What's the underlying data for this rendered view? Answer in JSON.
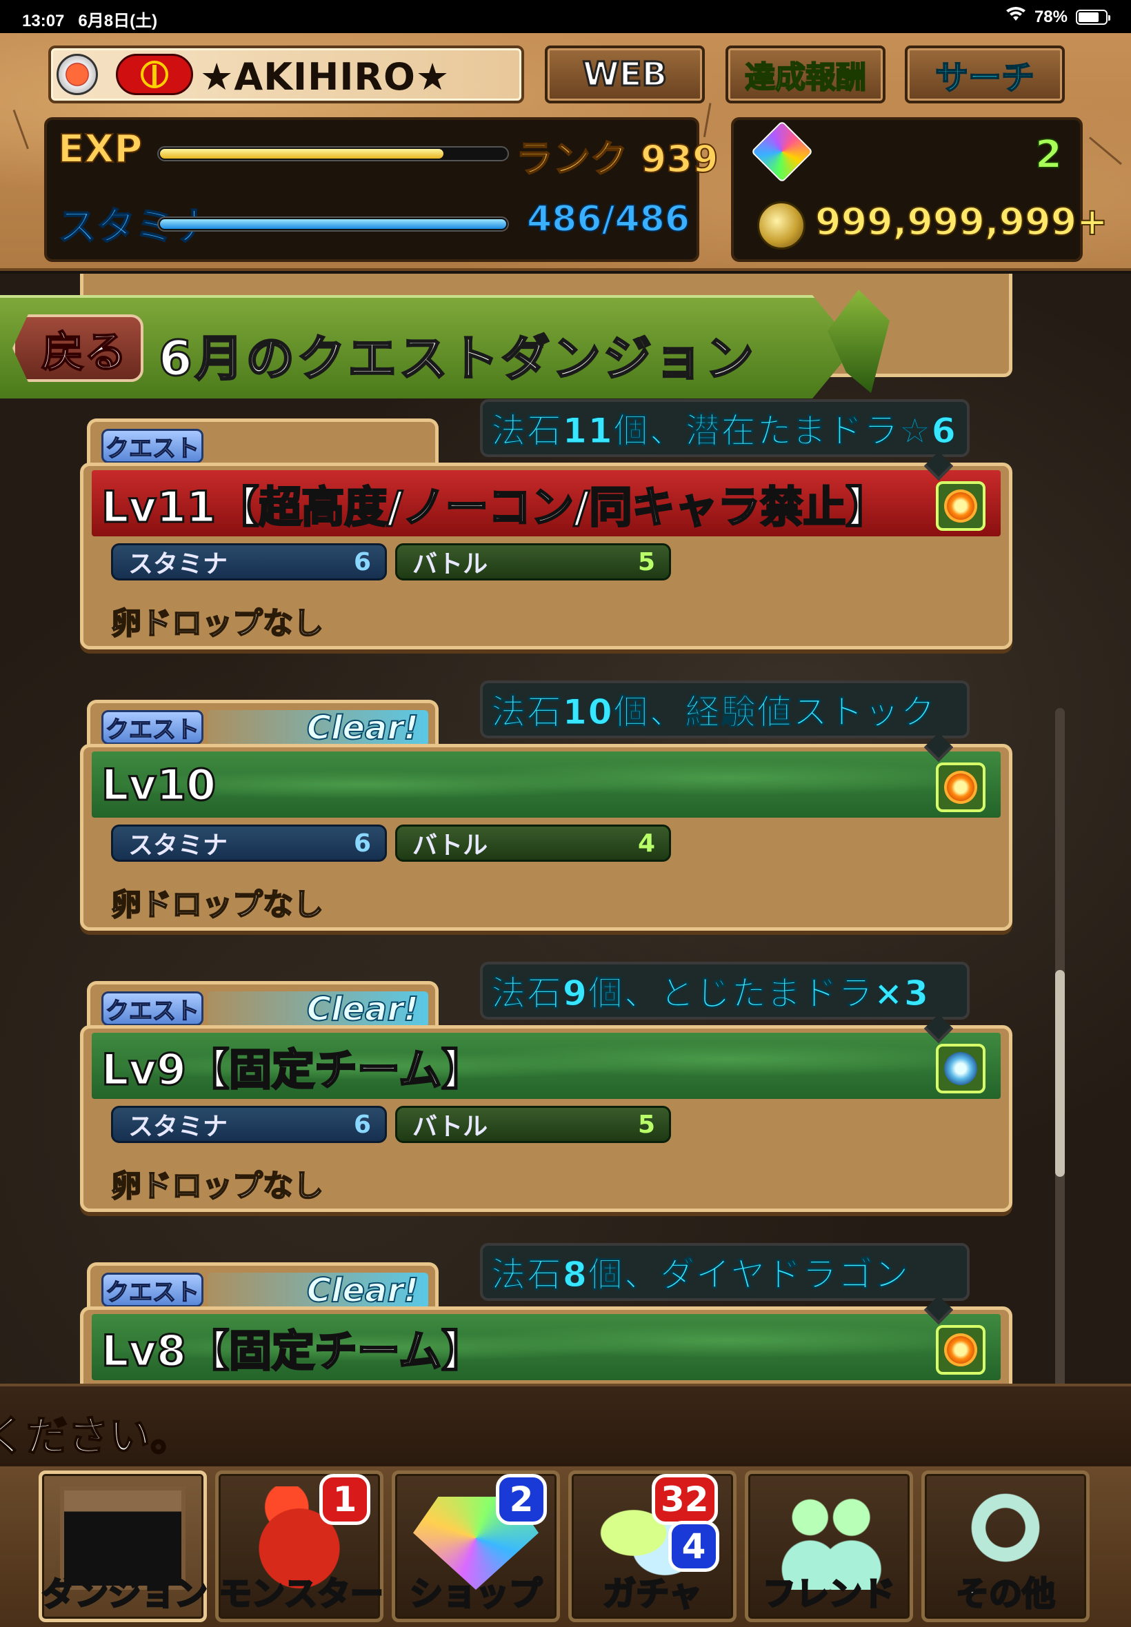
{
  "status": {
    "time": "13:07",
    "date": "6月8日(土)",
    "battery": "78%",
    "battery_level": 0.78
  },
  "header": {
    "player_name": "★AKIHIRO★",
    "web_button": "WEB",
    "reward_button": "達成報酬",
    "search_button": "サーチ",
    "exp_label": "EXP",
    "exp_progress": 0.82,
    "rank": "ランク 939",
    "stamina_label": "スタミナ",
    "stamina_progress": 1.0,
    "stamina_value": "486/486",
    "magic_stones": "2",
    "coins": "999,999,999+"
  },
  "nav": {
    "back_label": "戻る",
    "title": "6月のクエストダンジョン"
  },
  "cards": [
    {
      "tag": "クエスト",
      "clear": "",
      "reward": "法石11個、潜在たまドラ☆6",
      "title": "Lv11【超高度/ノーコン/同キャラ禁止】",
      "band": "red",
      "attr": "fire",
      "stamina_label": "スタミナ",
      "stamina": "6",
      "battle_label": "バトル",
      "battle": "5",
      "egg": "卵ドロップなし"
    },
    {
      "tag": "クエスト",
      "clear": "Clear!",
      "reward": "法石10個、経験値ストック",
      "title": "Lv10",
      "band": "green",
      "attr": "fire",
      "stamina_label": "スタミナ",
      "stamina": "6",
      "battle_label": "バトル",
      "battle": "4",
      "egg": "卵ドロップなし"
    },
    {
      "tag": "クエスト",
      "clear": "Clear!",
      "reward": "法石9個、とじたまドラ×3",
      "title": "Lv9【固定チーム】",
      "band": "green",
      "attr": "water",
      "stamina_label": "スタミナ",
      "stamina": "6",
      "battle_label": "バトル",
      "battle": "5",
      "egg": "卵ドロップなし"
    },
    {
      "tag": "クエスト",
      "clear": "Clear!",
      "reward": "法石8個、ダイヤドラゴン",
      "title": "Lv8【固定チーム】",
      "band": "green",
      "attr": "fire"
    }
  ],
  "message": "ください。",
  "tabs": [
    {
      "label": "ダンジョン",
      "badge": "",
      "badge2": ""
    },
    {
      "label": "モンスター",
      "badge": "1",
      "badge2": ""
    },
    {
      "label": "ショップ",
      "badge": "2",
      "badge2": ""
    },
    {
      "label": "ガチャ",
      "badge": "32",
      "badge2": "4"
    },
    {
      "label": "フレンド",
      "badge": "",
      "badge2": ""
    },
    {
      "label": "その他",
      "badge": "",
      "badge2": ""
    }
  ]
}
